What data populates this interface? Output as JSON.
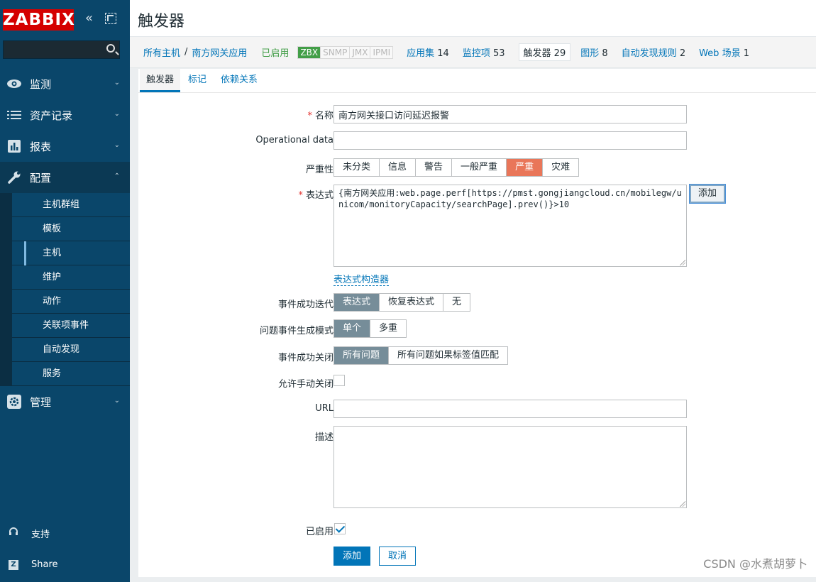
{
  "sidebar": {
    "logo": "ZABBIX",
    "collapse_icon": "«",
    "menu": [
      {
        "label": "监测",
        "icon": "eye-icon"
      },
      {
        "label": "资产记录",
        "icon": "list-icon"
      },
      {
        "label": "报表",
        "icon": "bar-chart-icon"
      },
      {
        "label": "配置",
        "icon": "wrench-icon"
      }
    ],
    "config_submenu": [
      "主机群组",
      "模板",
      "主机",
      "维护",
      "动作",
      "关联项事件",
      "自动发现",
      "服务"
    ],
    "admin": {
      "label": "管理",
      "icon": "gear-icon"
    },
    "support": "支持",
    "share": "Share"
  },
  "header": {
    "title": "触发器"
  },
  "breadcrumb": {
    "all_hosts": "所有主机",
    "separator": "/",
    "host": "南方网关应用",
    "enabled": "已启用",
    "status_tags": [
      "ZBX",
      "SNMP",
      "JMX",
      "IPMI"
    ],
    "links": [
      {
        "label": "应用集",
        "count": "14"
      },
      {
        "label": "监控项",
        "count": "53"
      }
    ],
    "current": {
      "label": "触发器",
      "count": "29"
    },
    "links2": [
      {
        "label": "图形",
        "count": "8"
      },
      {
        "label": "自动发现规则",
        "count": "2"
      },
      {
        "label": "Web 场景",
        "count": "1"
      }
    ]
  },
  "tabs": [
    "触发器",
    "标记",
    "依赖关系"
  ],
  "form": {
    "name_label": "名称",
    "name_value": "南方网关接口访问延迟报警",
    "opdata_label": "Operational data",
    "opdata_value": "",
    "severity_label": "严重性",
    "severity_options": [
      "未分类",
      "信息",
      "警告",
      "一般严重",
      "严重",
      "灾难"
    ],
    "severity_selected": "严重",
    "expression_label": "表达式",
    "expression_value": "{南方网关应用:web.page.perf[https://pmst.gongjiangcloud.cn/mobilegw/unicom/monitoryCapacity/searchPage].prev()}>10",
    "add_label": "添加",
    "expr_builder": "表达式构造器",
    "ok_event_label": "事件成功迭代",
    "ok_event_options": [
      "表达式",
      "恢复表达式",
      "无"
    ],
    "problem_mode_label": "问题事件生成模式",
    "problem_mode_options": [
      "单个",
      "多重"
    ],
    "ok_close_label": "事件成功关闭",
    "ok_close_options": [
      "所有问题",
      "所有问题如果标签值匹配"
    ],
    "manual_close_label": "允许手动关闭",
    "url_label": "URL",
    "url_value": "",
    "desc_label": "描述",
    "desc_value": "",
    "enabled_label": "已启用",
    "submit": "添加",
    "cancel": "取消"
  },
  "watermark": "CSDN @水煮胡萝卜"
}
